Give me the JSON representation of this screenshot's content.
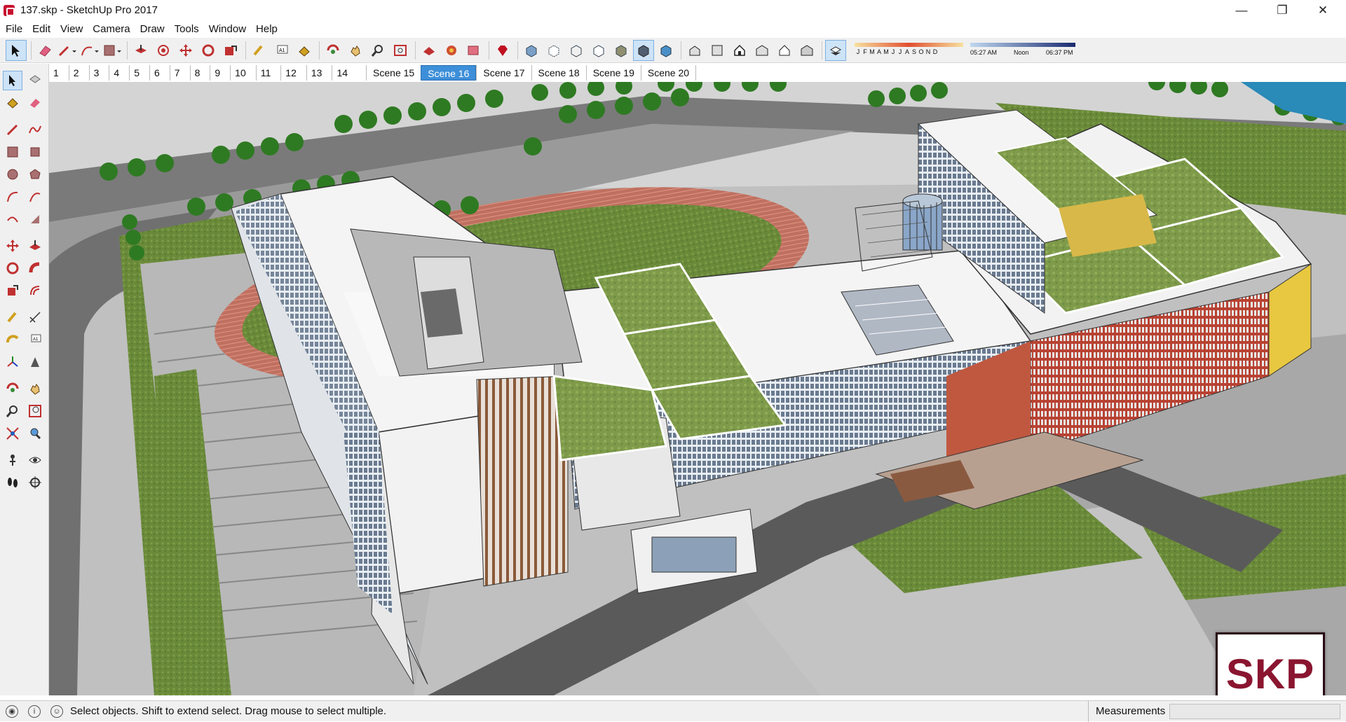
{
  "window": {
    "title": "137.skp - SketchUp Pro 2017",
    "minimize": "—",
    "maximize": "❐",
    "close": "✕"
  },
  "menu": [
    "File",
    "Edit",
    "View",
    "Camera",
    "Draw",
    "Tools",
    "Window",
    "Help"
  ],
  "shadow_settings": {
    "months": [
      "J",
      "F",
      "M",
      "A",
      "M",
      "J",
      "J",
      "A",
      "S",
      "O",
      "N",
      "D"
    ],
    "time_start": "05:27 AM",
    "time_noon": "Noon",
    "time_end": "06:37 PM"
  },
  "scenes": {
    "numbered": [
      "1",
      "2",
      "3",
      "4",
      "5",
      "6",
      "7",
      "8",
      "9",
      "10",
      "11",
      "12",
      "13",
      "14"
    ],
    "named": [
      "Scene 15",
      "Scene 16",
      "Scene 17",
      "Scene 18",
      "Scene 19",
      "Scene 20"
    ],
    "active": "Scene 16"
  },
  "status": {
    "hint": "Select objects. Shift to extend select. Drag mouse to select multiple.",
    "measurements_label": "Measurements",
    "measurements_value": ""
  },
  "watermark": "SKP",
  "colors": {
    "accent": "#3d8fd9",
    "brand": "#c8102e",
    "logo": "#8a1530"
  }
}
